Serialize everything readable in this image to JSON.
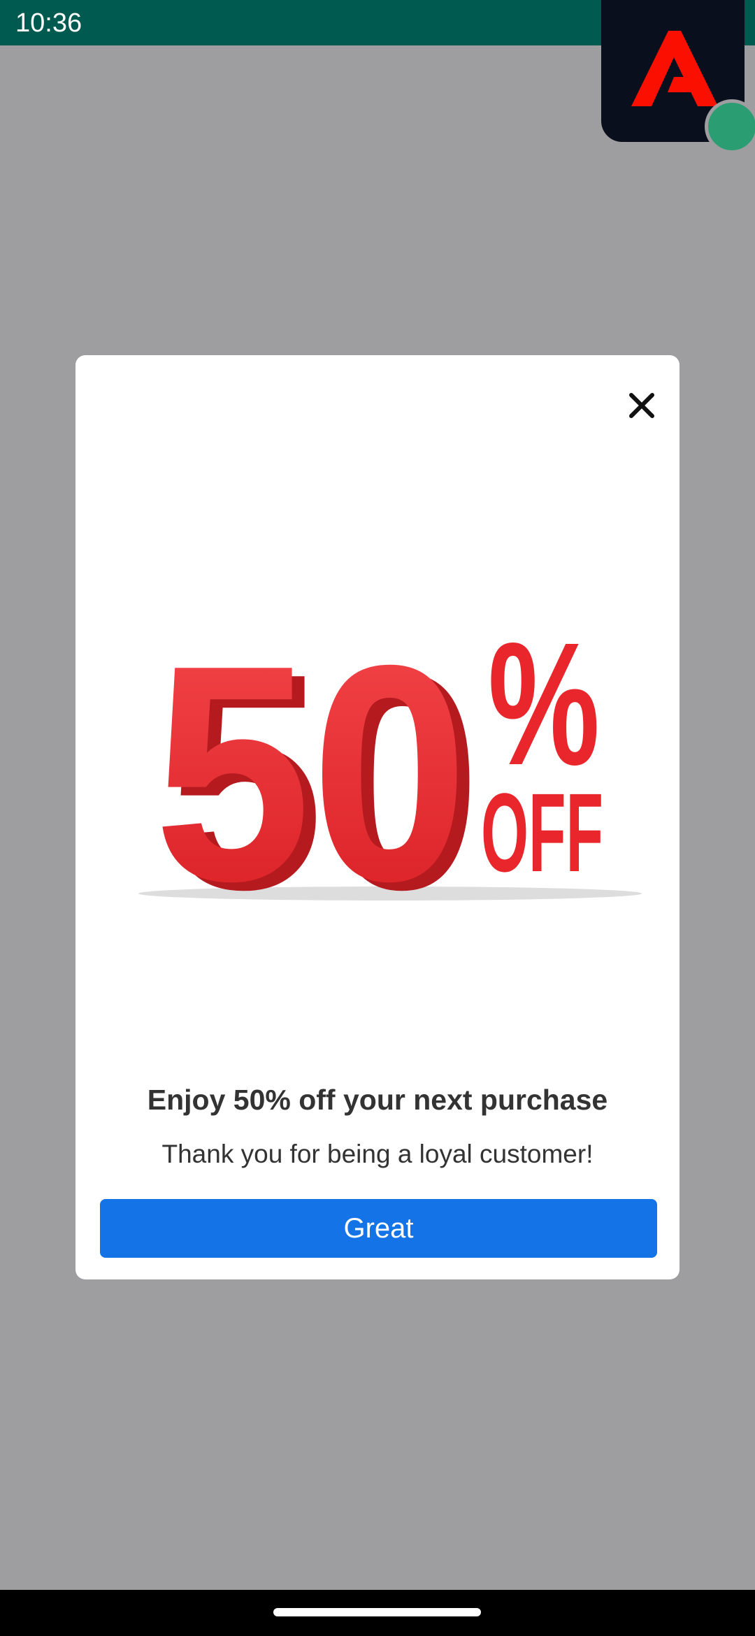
{
  "status_bar": {
    "time": "10:36",
    "icons": [
      "wifi-icon",
      "cellular-signal-icon",
      "battery-icon"
    ]
  },
  "floating_app": {
    "icon": "adobe-logo-icon",
    "badge_color": "#2a9d73"
  },
  "dialog": {
    "close_icon": "close-icon",
    "image": {
      "text_big": "50",
      "text_percent": "%",
      "text_off": "OFF",
      "color": "#e8262b"
    },
    "headline": "Enjoy 50% off your next purchase",
    "subtext": "Thank you for being a loyal customer!",
    "button_label": "Great",
    "button_color": "#1473e6"
  },
  "colors": {
    "status_bar": "#005a4f",
    "scrim": "#9e9ea0"
  }
}
